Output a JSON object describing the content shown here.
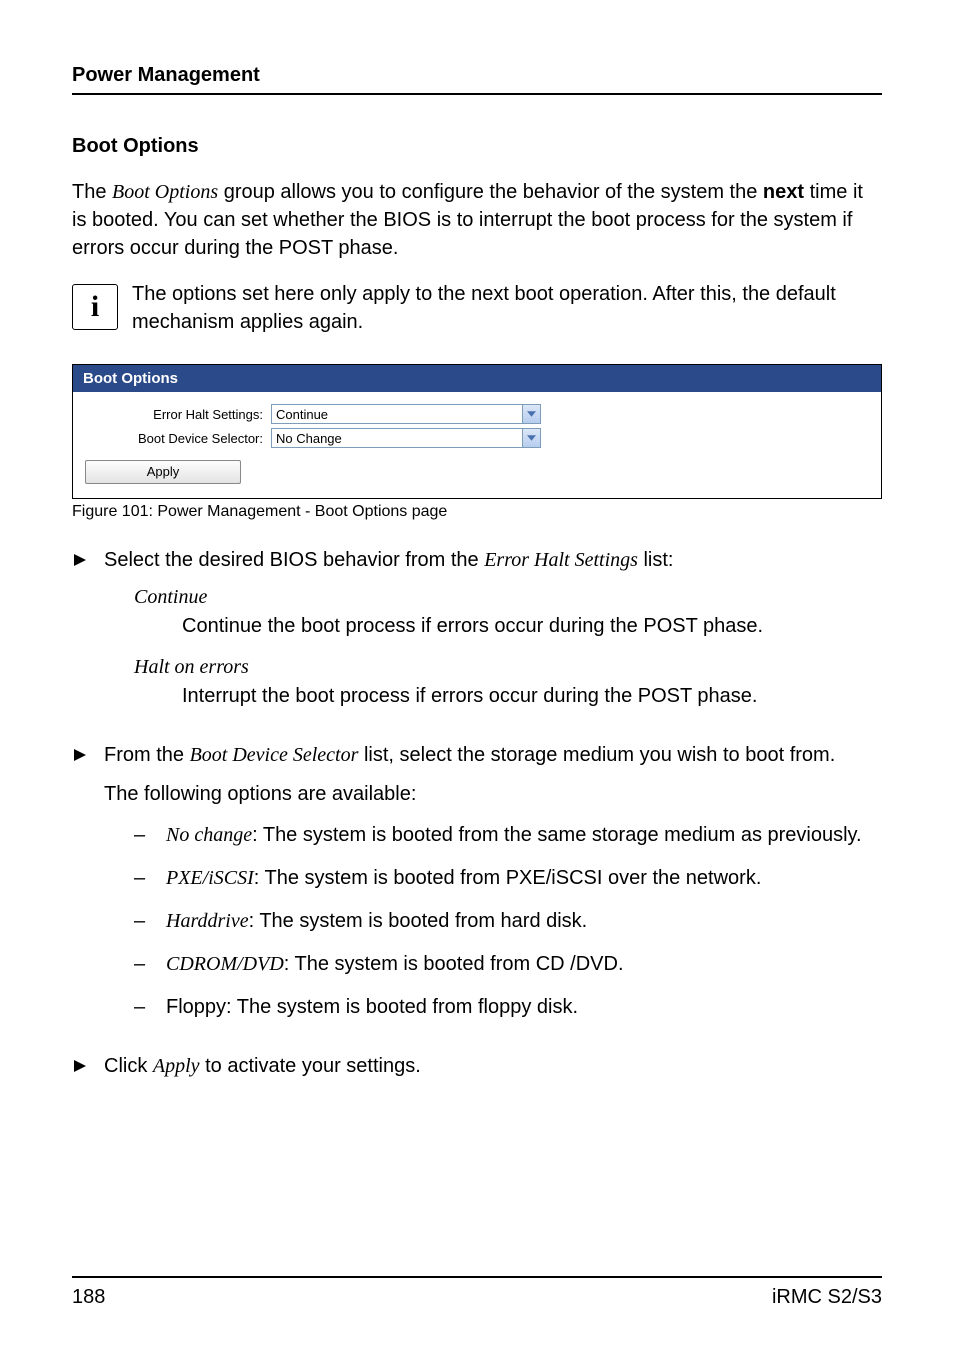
{
  "running_head": "Power Management",
  "section_head": "Boot Options",
  "intro": {
    "pre": "The ",
    "ital": "Boot Options",
    "mid": " group allows you to configure the behavior of the system the ",
    "bold": "next",
    "post": " time it is booted. You can set whether the BIOS is to interrupt the boot process for the system if errors occur during the POST phase."
  },
  "info_note": "The options set here only apply to the next boot operation. After this, the default mechanism applies again.",
  "figure": {
    "header": "Boot Options",
    "label1": "Error Halt Settings:",
    "value1": "Continue",
    "label2": "Boot Device Selector:",
    "value2": "No Change",
    "apply_label": "Apply",
    "caption": "Figure 101: Power Management - Boot Options page"
  },
  "step1": {
    "pre": "Select the desired BIOS behavior from the ",
    "ital": "Error Halt Settings",
    "post": " list:"
  },
  "defs": {
    "term1": "Continue",
    "desc1": "Continue the boot process if errors occur during the POST phase.",
    "term2": "Halt on errors",
    "desc2": "Interrupt the boot process if errors occur during the POST phase."
  },
  "step2": {
    "pre": "From the ",
    "ital": "Boot Device Selector",
    "post": " list, select the storage medium you wish to boot from."
  },
  "options_intro": "The following options are available:",
  "options": {
    "o1": {
      "ital": "No change",
      "rest": ": The system is booted from the same storage medium as previously."
    },
    "o2": {
      "ital": "PXE/iSCSI",
      "rest": ": The system is booted from PXE/iSCSI over the network."
    },
    "o3": {
      "ital": "Harddrive",
      "rest": ": The system is booted from hard disk."
    },
    "o4": {
      "ital": "CDROM/DVD",
      "rest": ": The system is booted from CD /DVD."
    },
    "o5": {
      "plain": "Floppy: The system is booted from floppy disk."
    }
  },
  "step3": {
    "pre": "Click ",
    "ital": "Apply",
    "post": " to activate your settings."
  },
  "footer": {
    "page": "188",
    "doc": "iRMC S2/S3"
  }
}
